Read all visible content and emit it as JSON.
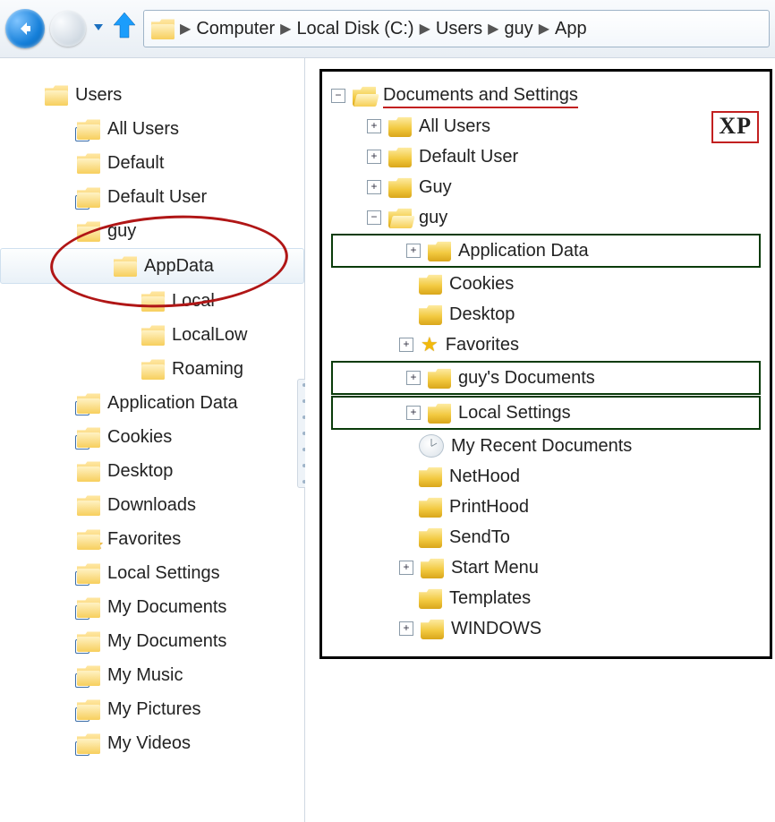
{
  "toolbar": {
    "breadcrumb": [
      "Computer",
      "Local Disk (C:)",
      "Users",
      "guy",
      "App"
    ]
  },
  "vista_tree": {
    "root": "Users",
    "items": [
      {
        "label": "All Users",
        "icon": "shortcut",
        "indent": 1
      },
      {
        "label": "Default",
        "icon": "folder",
        "indent": 1
      },
      {
        "label": "Default User",
        "icon": "shortcut",
        "indent": 1
      },
      {
        "label": "guy",
        "icon": "folder",
        "indent": 1,
        "circled": true
      },
      {
        "label": "AppData",
        "icon": "folder",
        "indent": 2,
        "selected": true,
        "circled": true
      },
      {
        "label": "Local",
        "icon": "folder",
        "indent": 3
      },
      {
        "label": "LocalLow",
        "icon": "folder",
        "indent": 3
      },
      {
        "label": "Roaming",
        "icon": "folder",
        "indent": 3
      },
      {
        "label": "Application Data",
        "icon": "shortcut",
        "indent": 1
      },
      {
        "label": "Cookies",
        "icon": "shortcut",
        "indent": 1
      },
      {
        "label": "Desktop",
        "icon": "folder",
        "indent": 1
      },
      {
        "label": "Downloads",
        "icon": "folder-down",
        "indent": 1
      },
      {
        "label": "Favorites",
        "icon": "folder-star",
        "indent": 1
      },
      {
        "label": "Local Settings",
        "icon": "shortcut",
        "indent": 1
      },
      {
        "label": "My Documents",
        "icon": "shortcut",
        "indent": 1
      },
      {
        "label": "My Documents",
        "icon": "shortcut",
        "indent": 1
      },
      {
        "label": "My Music",
        "icon": "shortcut",
        "indent": 1
      },
      {
        "label": "My Pictures",
        "icon": "shortcut",
        "indent": 1
      },
      {
        "label": "My Videos",
        "icon": "shortcut",
        "indent": 1
      }
    ]
  },
  "xp_tree": {
    "badge": "XP",
    "root": "Documents and Settings",
    "items": [
      {
        "label": "All Users",
        "exp": "+",
        "indent": 1
      },
      {
        "label": "Default User",
        "exp": "+",
        "indent": 1
      },
      {
        "label": "Guy",
        "exp": "+",
        "indent": 1
      },
      {
        "label": "guy",
        "exp": "-",
        "indent": 1
      },
      {
        "label": "Application Data",
        "exp": "+",
        "indent": 2,
        "highlight": true
      },
      {
        "label": "Cookies",
        "exp": "",
        "indent": 2
      },
      {
        "label": "Desktop",
        "exp": "",
        "indent": 2
      },
      {
        "label": "Favorites",
        "exp": "+",
        "indent": 2,
        "icon": "star"
      },
      {
        "label": "guy's Documents",
        "exp": "+",
        "indent": 2,
        "highlight": true
      },
      {
        "label": "Local Settings",
        "exp": "+",
        "indent": 2,
        "highlight": true
      },
      {
        "label": "My Recent Documents",
        "exp": "",
        "indent": 2,
        "icon": "recent"
      },
      {
        "label": "NetHood",
        "exp": "",
        "indent": 2
      },
      {
        "label": "PrintHood",
        "exp": "",
        "indent": 2
      },
      {
        "label": "SendTo",
        "exp": "",
        "indent": 2
      },
      {
        "label": "Start Menu",
        "exp": "+",
        "indent": 2
      },
      {
        "label": "Templates",
        "exp": "",
        "indent": 2
      },
      {
        "label": "WINDOWS",
        "exp": "+",
        "indent": 2
      }
    ]
  }
}
